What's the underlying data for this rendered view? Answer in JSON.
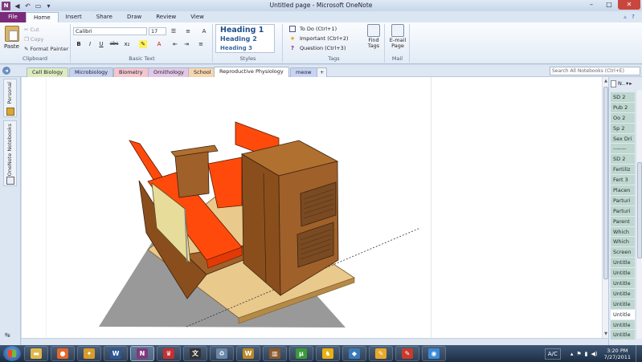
{
  "window": {
    "title": "Untitled page - Microsoft OneNote",
    "app_icon": "N"
  },
  "ribbon_tabs": [
    "Home",
    "Insert",
    "Share",
    "Draw",
    "Review",
    "View"
  ],
  "file_tab": "File",
  "clipboard": {
    "paste": "Paste",
    "cut": "Cut",
    "copy": "Copy",
    "format_painter": "Format Painter",
    "label": "Clipboard"
  },
  "basic_text": {
    "font": "Calibri",
    "size": "17",
    "bold": "B",
    "italic": "I",
    "underline": "U",
    "strike": "abc",
    "label": "Basic Text"
  },
  "styles": {
    "heading1": "Heading 1",
    "heading2": "Heading 2",
    "heading3": "Heading 3",
    "label": "Styles"
  },
  "tags": {
    "todo": "To Do (Ctrl+1)",
    "important": "Important (Ctrl+2)",
    "question": "Question (Ctrl+3)",
    "label": "Tags"
  },
  "find_tags": "Find Tags",
  "email": {
    "button": "E-mail Page",
    "label": "Mail"
  },
  "sections": [
    {
      "label": "Cell Biology",
      "color": "#dcecc0"
    },
    {
      "label": "Microbiology",
      "color": "#c6d2f0"
    },
    {
      "label": "Biometry",
      "color": "#f4c6d0"
    },
    {
      "label": "Ornithology",
      "color": "#e2c8e8"
    },
    {
      "label": "School",
      "color": "#f6d6b0"
    },
    {
      "label": "Reproductive Physiology",
      "color": "#ffffff"
    },
    {
      "label": "meow",
      "color": "#c8d4f4"
    }
  ],
  "add_section": "+",
  "search_placeholder": "Search All Notebooks (Ctrl+E)",
  "notebooks": {
    "personal": "Personal",
    "onenote_notebooks": "OneNote Notebooks"
  },
  "pagelist": {
    "new_page": "N..",
    "items": [
      "SD 2",
      "Pub 2",
      "Oo 2",
      "Sp 2",
      "Sex Dri",
      "-------",
      "SD 2",
      "Fertiliz",
      "Fert 3",
      "Placen",
      "Parturi",
      "Parturi",
      "Parent",
      "Which",
      "Which",
      "Screen",
      "Untitle",
      "Untitle",
      "Untitle",
      "Untitle",
      "Untitle",
      "Untitle",
      "Untitle",
      "Untitle"
    ],
    "selected_index": 21
  },
  "taskbar": {
    "items": [
      {
        "icon": "folder-icon",
        "glyph": "▬",
        "color": "#e0b84a"
      },
      {
        "icon": "firefox-icon",
        "glyph": "●",
        "color": "#e2682a"
      },
      {
        "icon": "chat-icon",
        "glyph": "✦",
        "color": "#d99b2a"
      },
      {
        "icon": "word-icon",
        "glyph": "W",
        "color": "#2b5797"
      },
      {
        "icon": "onenote-icon",
        "glyph": "N",
        "color": "#80397b"
      },
      {
        "icon": "chinese-app-icon",
        "glyph": "♛",
        "color": "#c43030"
      },
      {
        "icon": "dictionary-icon",
        "glyph": "文",
        "color": "#333333"
      },
      {
        "icon": "recycle-icon",
        "glyph": "♻",
        "color": "#6a88aa"
      },
      {
        "icon": "wow-icon",
        "glyph": "W",
        "color": "#b8892a"
      },
      {
        "icon": "library-icon",
        "glyph": "▥",
        "color": "#8a5a2a"
      },
      {
        "icon": "utorrent-icon",
        "glyph": "μ",
        "color": "#3a9a3a"
      },
      {
        "icon": "aim-icon",
        "glyph": "♞",
        "color": "#e8b010"
      },
      {
        "icon": "pad-icon",
        "glyph": "◆",
        "color": "#3a7ab8"
      },
      {
        "icon": "pencil-icon",
        "glyph": "✎",
        "color": "#e8a82a"
      },
      {
        "icon": "sketchup-icon",
        "glyph": "✎",
        "color": "#c83a2a"
      },
      {
        "icon": "paint-icon",
        "glyph": "◉",
        "color": "#3a8ad8"
      }
    ],
    "lang": "A/C",
    "time": "3:20 PM",
    "date": "7/27/2011"
  },
  "colors": {
    "accent": "#80397b",
    "tab_border": "#a9bfd8",
    "page_bg": "#ffffff",
    "furniture_orange": "#ff4a0c",
    "wood_brown": "#9a5a22"
  }
}
